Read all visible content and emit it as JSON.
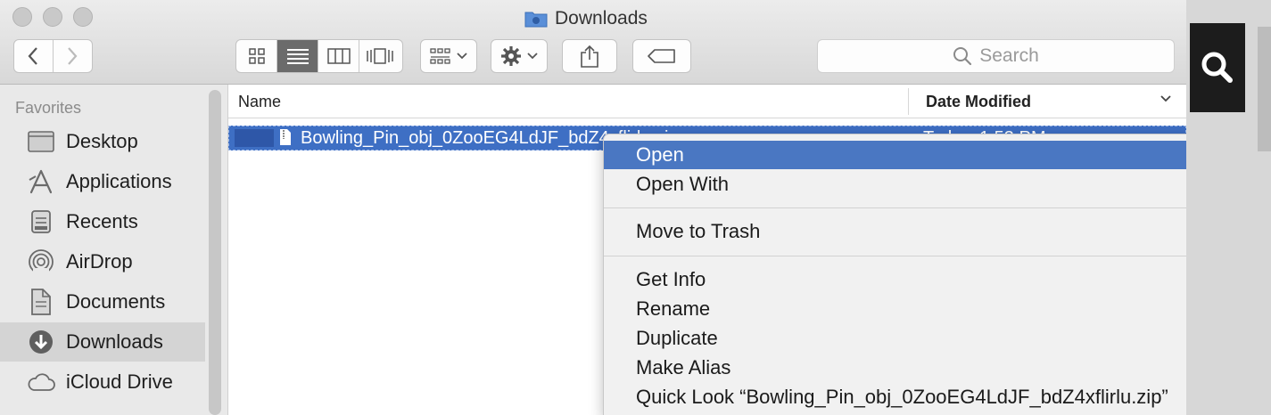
{
  "window": {
    "title": "Downloads"
  },
  "toolbar": {
    "view_modes": [
      "icon-view",
      "list-view",
      "column-view",
      "cover-flow-view"
    ],
    "active_view": "list-view",
    "search_placeholder": "Search"
  },
  "sidebar": {
    "section": "Favorites",
    "items": [
      {
        "label": "Desktop",
        "icon": "desktop-icon"
      },
      {
        "label": "Applications",
        "icon": "applications-icon"
      },
      {
        "label": "Recents",
        "icon": "recents-icon"
      },
      {
        "label": "AirDrop",
        "icon": "airdrop-icon"
      },
      {
        "label": "Documents",
        "icon": "documents-icon"
      },
      {
        "label": "Downloads",
        "icon": "downloads-icon",
        "selected": true
      },
      {
        "label": "iCloud Drive",
        "icon": "icloud-icon"
      }
    ]
  },
  "list": {
    "columns": {
      "name": "Name",
      "date": "Date Modified"
    },
    "rows": [
      {
        "name": "Bowling_Pin_obj_0ZooEG4LdJF_bdZ4xflirlu.zip",
        "date": "Today, 1:53 PM",
        "selected": true
      }
    ]
  },
  "context_menu": {
    "items": [
      {
        "label": "Open",
        "highlighted": true
      },
      {
        "label": "Open With",
        "submenu": true
      },
      {
        "label": "Move to Trash"
      },
      {
        "label": "Get Info"
      },
      {
        "label": "Rename"
      },
      {
        "label": "Duplicate"
      },
      {
        "label": "Make Alias"
      },
      {
        "label": "Quick Look “Bowling_Pin_obj_0ZooEG4LdJF_bdZ4xflirlu.zip”"
      }
    ]
  },
  "colors": {
    "selection": "#3e6fc4",
    "menu_highlight": "#4a77c2"
  }
}
